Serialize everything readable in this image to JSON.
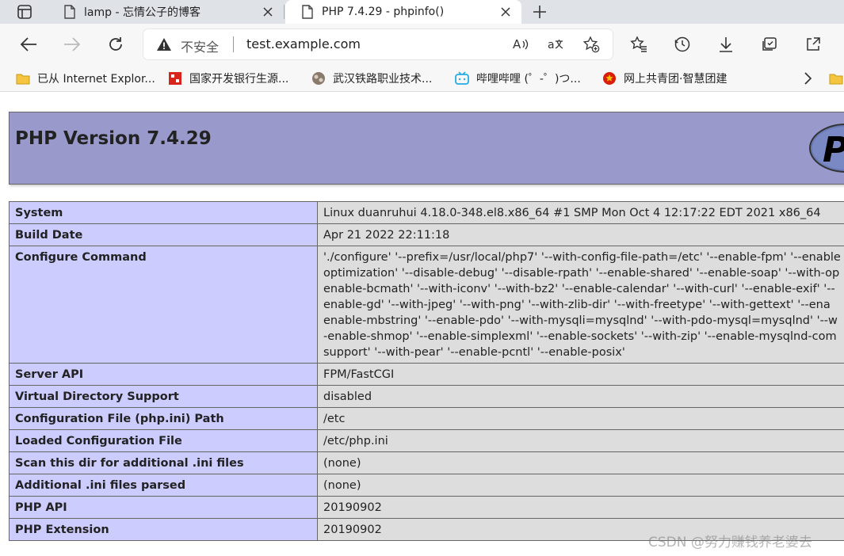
{
  "browser": {
    "tabs": [
      {
        "title": "lamp - 忘情公子的博客",
        "active": false
      },
      {
        "title": "PHP 7.4.29 - phpinfo()",
        "active": true
      }
    ],
    "address": {
      "security_label": "不安全",
      "url": "test.example.com"
    },
    "bookmarks": [
      {
        "label": "已从 Internet Explor...",
        "icon": "folder-icon"
      },
      {
        "label": "国家开发银行生源...",
        "icon": "cdb-logo-icon"
      },
      {
        "label": "武汉铁路职业技术...",
        "icon": "school-logo-icon"
      },
      {
        "label": "哔哩哔哩 (゜-゜)つ...",
        "icon": "bilibili-icon"
      },
      {
        "label": "网上共青团·智慧团建",
        "icon": "league-emblem-icon"
      }
    ]
  },
  "page": {
    "version_title": "PHP Version 7.4.29",
    "rows": [
      {
        "name": "System",
        "value": [
          "Linux duanruhui 4.18.0-348.el8.x86_64 #1 SMP Mon Oct 4 12:17:22 EDT 2021 x86_64"
        ]
      },
      {
        "name": "Build Date",
        "value": [
          "Apr 21 2022 22:11:18"
        ]
      },
      {
        "name": "Configure Command",
        "value": [
          "'./configure' '--prefix=/usr/local/php7' '--with-config-file-path=/etc' '--enable-fpm' '--enable",
          "optimization' '--disable-debug' '--disable-rpath' '--enable-shared' '--enable-soap' '--with-op",
          "enable-bcmath' '--with-iconv' '--with-bz2' '--enable-calendar' '--with-curl' '--enable-exif' '--",
          "enable-gd' '--with-jpeg' '--with-png' '--with-zlib-dir' '--with-freetype' '--with-gettext' '--ena",
          "enable-mbstring' '--enable-pdo' '--with-mysqli=mysqlnd' '--with-pdo-mysql=mysqlnd' '--w",
          "-enable-shmop' '--enable-simplexml' '--enable-sockets' '--with-zip' '--enable-mysqlnd-com",
          "support' '--with-pear' '--enable-pcntl' '--enable-posix'"
        ]
      },
      {
        "name": "Server API",
        "value": [
          "FPM/FastCGI"
        ]
      },
      {
        "name": "Virtual Directory Support",
        "value": [
          "disabled"
        ]
      },
      {
        "name": "Configuration File (php.ini) Path",
        "value": [
          "/etc"
        ]
      },
      {
        "name": "Loaded Configuration File",
        "value": [
          "/etc/php.ini"
        ]
      },
      {
        "name": "Scan this dir for additional .ini files",
        "value": [
          "(none)"
        ]
      },
      {
        "name": "Additional .ini files parsed",
        "value": [
          "(none)"
        ]
      },
      {
        "name": "PHP API",
        "value": [
          "20190902"
        ]
      },
      {
        "name": "PHP Extension",
        "value": [
          "20190902"
        ]
      }
    ]
  },
  "watermark": "CSDN @努力赚钱养老婆去",
  "colors": {
    "header_bg": "#9999cc",
    "label_cell_bg": "#ccccff",
    "value_cell_bg": "#dddddd"
  }
}
